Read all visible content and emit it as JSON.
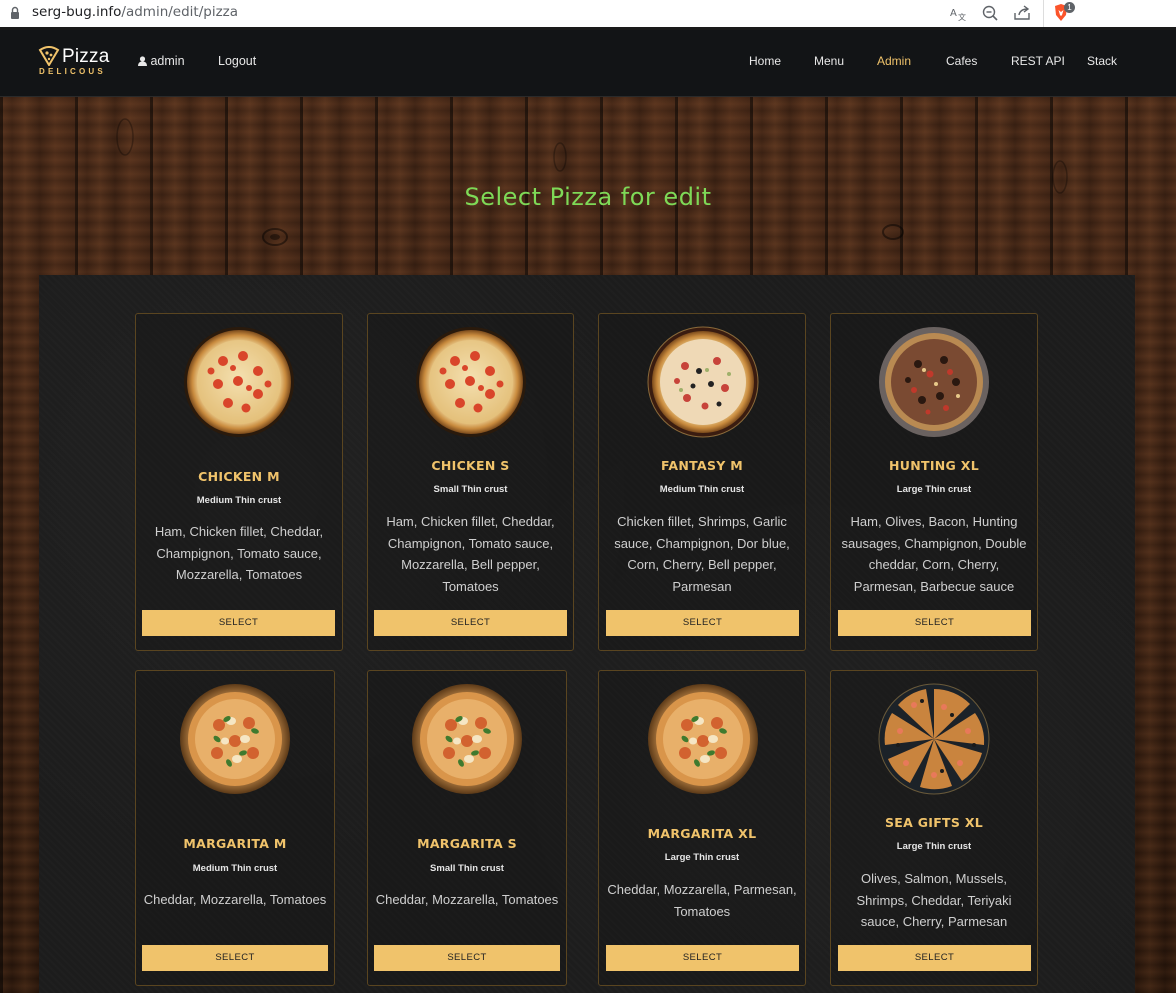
{
  "browser": {
    "url_host": "serg-bug.info",
    "url_path": "/admin/edit/pizza",
    "extension_badge": "1"
  },
  "navbar": {
    "logo_word": "Pizza",
    "logo_sub": "DELICOUS",
    "user_label": "admin",
    "logout_label": "Logout",
    "links": [
      "Home",
      "Menu",
      "Admin",
      "Cafes",
      "REST API",
      "Stack"
    ],
    "active_link": "Admin",
    "accent_color": "#f0c36b"
  },
  "page": {
    "title": "Select Pizza for edit",
    "title_color": "#7ed957"
  },
  "pizzas": [
    {
      "name": "CHICKEN M",
      "crust": "Medium Thin crust",
      "ingredients": "Ham, Chicken fillet, Cheddar, Champignon, Tomato sauce, Mozzarella, Tomatoes",
      "button": "SELECT",
      "image": "pepperoni-pizza-icon"
    },
    {
      "name": "CHICKEN S",
      "crust": "Small Thin crust",
      "ingredients": "Ham, Chicken fillet, Cheddar, Champignon, Tomato sauce, Mozzarella, Bell pepper, Tomatoes",
      "button": "SELECT",
      "image": "pepperoni-pizza-icon"
    },
    {
      "name": "FANTASY M",
      "crust": "Medium Thin crust",
      "ingredients": "Chicken fillet, Shrimps, Garlic sauce, Champignon, Dor blue, Corn, Cherry, Bell pepper, Parmesan",
      "button": "SELECT",
      "image": "mixed-pizza-icon"
    },
    {
      "name": "HUNTING XL",
      "crust": "Large Thin crust",
      "ingredients": "Ham, Olives, Bacon, Hunting sausages, Champignon, Double cheddar, Corn, Cherry, Parmesan, Barbecue sauce",
      "button": "SELECT",
      "image": "dark-pizza-icon"
    },
    {
      "name": "MARGARITA M",
      "crust": "Medium Thin crust",
      "ingredients": "Cheddar, Mozzarella, Tomatoes",
      "button": "SELECT",
      "image": "margarita-pizza-icon"
    },
    {
      "name": "MARGARITA S",
      "crust": "Small Thin crust",
      "ingredients": "Cheddar, Mozzarella, Tomatoes",
      "button": "SELECT",
      "image": "margarita-pizza-icon"
    },
    {
      "name": "MARGARITA XL",
      "crust": "Large Thin crust",
      "ingredients": "Cheddar, Mozzarella, Parmesan, Tomatoes",
      "button": "SELECT",
      "image": "margarita-pizza-icon"
    },
    {
      "name": "SEA GIFTS XL",
      "crust": "Large Thin crust",
      "ingredients": "Olives, Salmon, Mussels, Shrimps, Cheddar, Teriyaki sauce, Cherry, Parmesan",
      "button": "SELECT",
      "image": "seafood-pizza-icon"
    }
  ]
}
